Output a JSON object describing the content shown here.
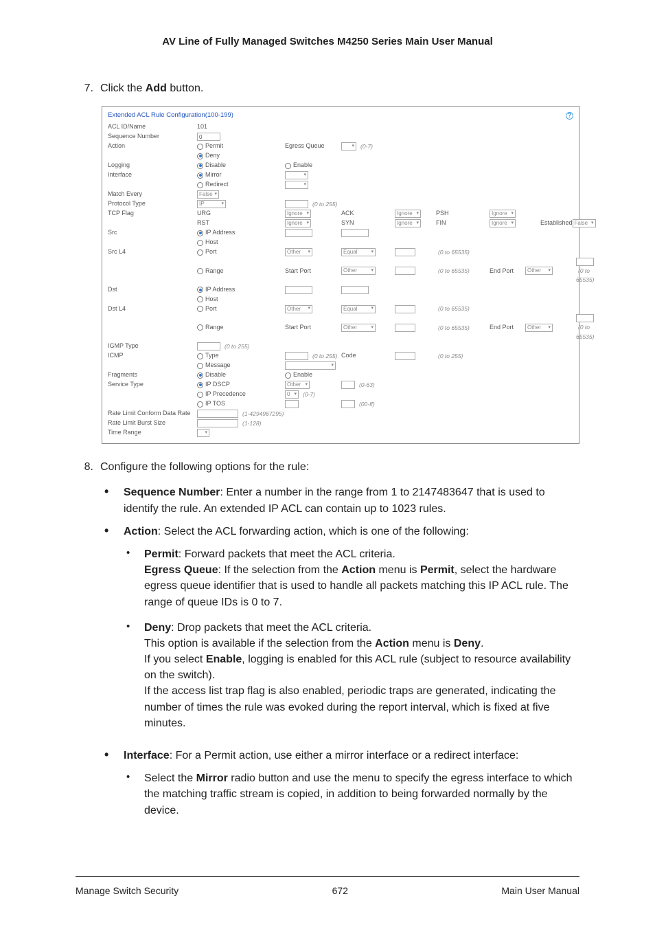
{
  "header_title": "AV Line of Fully Managed Switches M4250 Series Main User Manual",
  "step7": {
    "num": "7.",
    "pre": "Click the ",
    "bold": "Add",
    "post": " button."
  },
  "ss_title": "Extended ACL Rule Configuration(100-199)",
  "fields": {
    "acl_id": {
      "label": "ACL ID/Name",
      "value": "101"
    },
    "seq": {
      "label": "Sequence Number",
      "value": "0"
    },
    "action": {
      "label": "Action",
      "permit": "Permit",
      "deny": "Deny"
    },
    "egress_queue": {
      "label": "Egress Queue",
      "hint": "(0-7)"
    },
    "logging": {
      "label": "Logging",
      "disable": "Disable",
      "enable": "Enable"
    },
    "interface": {
      "label": "Interface",
      "mirror": "Mirror",
      "redirect": "Redirect"
    },
    "match_every": {
      "label": "Match Every",
      "value": "False"
    },
    "protocol_type": {
      "label": "Protocol Type",
      "value": "IP",
      "hint": "(0 to 255)"
    },
    "tcp_flag": {
      "label": "TCP Flag",
      "urg": "URG",
      "ack": "ACK",
      "psh": "PSH",
      "rst": "RST",
      "syn": "SYN",
      "fin": "FIN",
      "est": "Established",
      "ignore": "Ignore",
      "false": "False"
    },
    "src": {
      "label": "Src",
      "ip": "IP Address",
      "host": "Host"
    },
    "src_l4": {
      "label": "Src L4",
      "port": "Port",
      "range": "Range",
      "other": "Other",
      "equal": "Equal",
      "start": "Start Port",
      "end": "End Port",
      "h1": "(0 to 65535)",
      "h2": "(0 to 65535)",
      "h3": "(0 to 65535)"
    },
    "dst": {
      "label": "Dst",
      "ip": "IP Address",
      "host": "Host"
    },
    "dst_l4": {
      "label": "Dst L4",
      "port": "Port",
      "range": "Range",
      "other": "Other",
      "equal": "Equal",
      "start": "Start Port",
      "end": "End Port",
      "h1": "(0 to 65535)",
      "h2": "(0 to 65535)",
      "h3": "(0 to 65535)"
    },
    "igmp_type": {
      "label": "IGMP Type",
      "hint": "(0 to 255)"
    },
    "icmp": {
      "label": "ICMP",
      "type": "Type",
      "message": "Message",
      "code": "Code",
      "h1": "(0 to 255)",
      "h2": "(0 to 255)"
    },
    "fragments": {
      "label": "Fragments",
      "disable": "Disable",
      "enable": "Enable"
    },
    "service_type": {
      "label": "Service Type",
      "dscp": "IP DSCP",
      "prec": "IP Precedence",
      "tos": "IP TOS",
      "other": "Other",
      "zero": "0",
      "h1": "(0-63)",
      "h2": "(0-7)",
      "h3": "(00-ff)"
    },
    "rate_data": {
      "label": "Rate Limit Conform Data Rate",
      "hint": "(1-4294967295)"
    },
    "rate_burst": {
      "label": "Rate Limit Burst Size",
      "hint": "(1-128)"
    },
    "time_range": {
      "label": "Time Range"
    }
  },
  "step8": {
    "num": "8.",
    "text": "Configure the following options for the rule:"
  },
  "b_seq": {
    "bold": "Sequence Number",
    "text": ": Enter a number in the range from 1 to 2147483647 that is used to identify the rule. An extended IP ACL can contain up to 1023 rules."
  },
  "b_action": {
    "bold": "Action",
    "text": ": Select the ACL forwarding action, which is one of the following:"
  },
  "b_permit": {
    "bold1": "Permit",
    "t1": ": Forward packets that meet the ACL criteria.",
    "bold2": "Egress Queue",
    "t2a": ": If the selection from the ",
    "bold3": "Action",
    "t2b": " menu is ",
    "bold4": "Permit",
    "t2c": ", select the hardware egress queue identifier that is used to handle all packets matching this IP ACL rule. The range of queue IDs is 0 to 7."
  },
  "b_deny": {
    "bold1": "Deny",
    "t1": ": Drop packets that meet the ACL criteria.",
    "t2a": "This option is available if the selection from the ",
    "bold2": "Action",
    "t2b": " menu is ",
    "bold3": "Deny",
    "t2c": ".",
    "t3a": "If you select ",
    "bold4": "Enable",
    "t3b": ", logging is enabled for this ACL rule (subject to resource availability on the switch).",
    "t4": "If the access list trap flag is also enabled, periodic traps are generated, indicating the number of times the rule was evoked during the report interval, which is fixed at five minutes."
  },
  "b_interface": {
    "bold": "Interface",
    "text": ": For a Permit action, use either a mirror interface or a redirect interface:"
  },
  "b_mirror": {
    "t1": "Select the ",
    "bold": "Mirror",
    "t2": " radio button and use the menu to specify the egress interface to which the matching traffic stream is copied, in addition to being forwarded normally by the device."
  },
  "footer": {
    "left": "Manage Switch Security",
    "center": "672",
    "right": "Main User Manual"
  }
}
